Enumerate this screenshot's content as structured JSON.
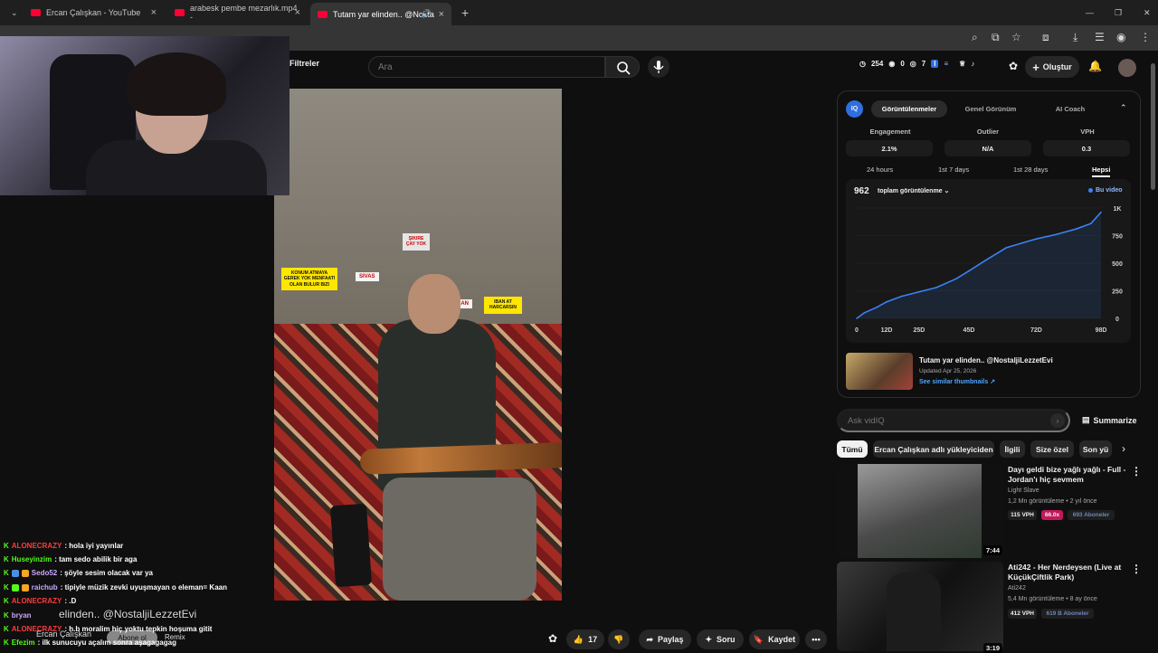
{
  "browser": {
    "tabs": [
      {
        "title": "Ercan Çalışkan - YouTube"
      },
      {
        "title": "arabesk pembe mezarlık.mp4 -"
      },
      {
        "title": "Tutam yar elinden.. @Nosta"
      }
    ],
    "new_tab": "+",
    "close": "×",
    "window_min": "—",
    "window_max": "❐",
    "window_close": "✕"
  },
  "masthead": {
    "filters_label": "Filtreler",
    "search_placeholder": "Ara",
    "stats": {
      "clock": "254",
      "views": "0",
      "eye": "7"
    },
    "create_label": "Oluştur"
  },
  "video": {
    "sign_text": "KONUM ATMAYA GEREK YOK MENFAATI OLAN BULUR BIZI",
    "placard_left": "SIVAS",
    "placard_mid": "ERZINCAN",
    "sign2_text": "IBAN AT HARCARSIN",
    "poster_text": "ŞIKIRE ÇAY YOK"
  },
  "chat": [
    {
      "user": "ALONECRAZY",
      "user_color": "#ff3b3b",
      "msg": ": hola iyi yayınlar"
    },
    {
      "user": "Huseyinzim",
      "user_color": "#53fc18",
      "msg": ": tam sedo abilik bir aga"
    },
    {
      "user": "Sedo52",
      "user_color": "#c9a7ff",
      "msg": ": şöyle sesim olacak var ya"
    },
    {
      "user": "raichub",
      "user_color": "#c9a7ff",
      "msg": ": tipiyle müzik zevki uyuşmayan o eleman= Kaan"
    },
    {
      "user": "ALONECRAZY",
      "user_color": "#ff3b3b",
      "msg": ": .D"
    },
    {
      "user": "bryan",
      "user_color": "#c9a7ff",
      "msg": ""
    },
    {
      "user": "ALONECRAZY",
      "user_color": "#ff3b3b",
      "msg": ": h.b moralim hiç yoktu tepkin hoşuma gitit"
    },
    {
      "user": "Efezim",
      "user_color": "#53fc18",
      "msg": ": ilk sunucuyu açalım sonra aşagagagag"
    }
  ],
  "overlay": {
    "title": "elinden.. @NostaljiLezzetEvi",
    "channel": "Ercan Çalışkan",
    "subscribe": "Abone ol",
    "remix": "Remix"
  },
  "actions": {
    "likes": "17",
    "share": "Paylaş",
    "ask": "Soru",
    "save": "Kaydet"
  },
  "iq": {
    "logo": "IQ",
    "tabs": [
      "Görüntülenmeler",
      "Genel Görünüm",
      "AI Coach"
    ],
    "metrics": [
      {
        "label": "Engagement",
        "value": "2.1%"
      },
      {
        "label": "Outlier",
        "value": "N/A"
      },
      {
        "label": "VPH",
        "value": "0.3"
      }
    ],
    "ranges": [
      "24 hours",
      "1st 7 days",
      "1st 28 days",
      "Hepsi"
    ],
    "active_range": "Hepsi",
    "total": "962",
    "total_label": "toplam görüntülenme",
    "legend": "Bu video",
    "video_title": "Tutam yar elinden.. @NostaljiLezzetEvi",
    "updated": "Updated Apr 25, 2026",
    "similar": "See similar thumbnails ↗"
  },
  "chart_data": {
    "type": "line",
    "x_ticks": [
      "0",
      "12D",
      "25D",
      "45D",
      "72D",
      "98D"
    ],
    "y_ticks": [
      "0",
      "250",
      "500",
      "750",
      "1K"
    ],
    "ylim": [
      0,
      1000
    ],
    "series": [
      {
        "name": "Bu video",
        "color": "#3b82f6",
        "x": [
          0,
          3,
          8,
          12,
          18,
          25,
          32,
          40,
          45,
          52,
          60,
          66,
          72,
          80,
          88,
          94,
          98
        ],
        "y": [
          0,
          50,
          100,
          150,
          200,
          240,
          280,
          360,
          430,
          530,
          640,
          680,
          720,
          760,
          810,
          860,
          962
        ]
      }
    ]
  },
  "assistant": {
    "placeholder": "Ask vidIQ",
    "summarize": "Summarize"
  },
  "chips": [
    "Tümü",
    "Ercan Çalışkan adlı yükleyiciden",
    "İlgili",
    "Size özel",
    "Son yü"
  ],
  "recommendations": [
    {
      "title": "Dayı geldi bize yağlı yağlı - Full - Jordan'ı hiç sevmem",
      "channel": "Light Slave",
      "meta": "1,2 Mn görüntüleme • 2 yıl önce",
      "vph": "115 VPH",
      "multiplier": "66.0x",
      "subs": "693 Aboneler",
      "duration": "7:44"
    },
    {
      "title": "Ati242 - Her Nerdeysen (Live at KüçükÇiftlik Park)",
      "channel": "Ati242",
      "meta": "5,4 Mn görüntüleme • 8 ay önce",
      "vph": "412 VPH",
      "subs": "619 B Aboneler",
      "duration": "3:19"
    }
  ]
}
